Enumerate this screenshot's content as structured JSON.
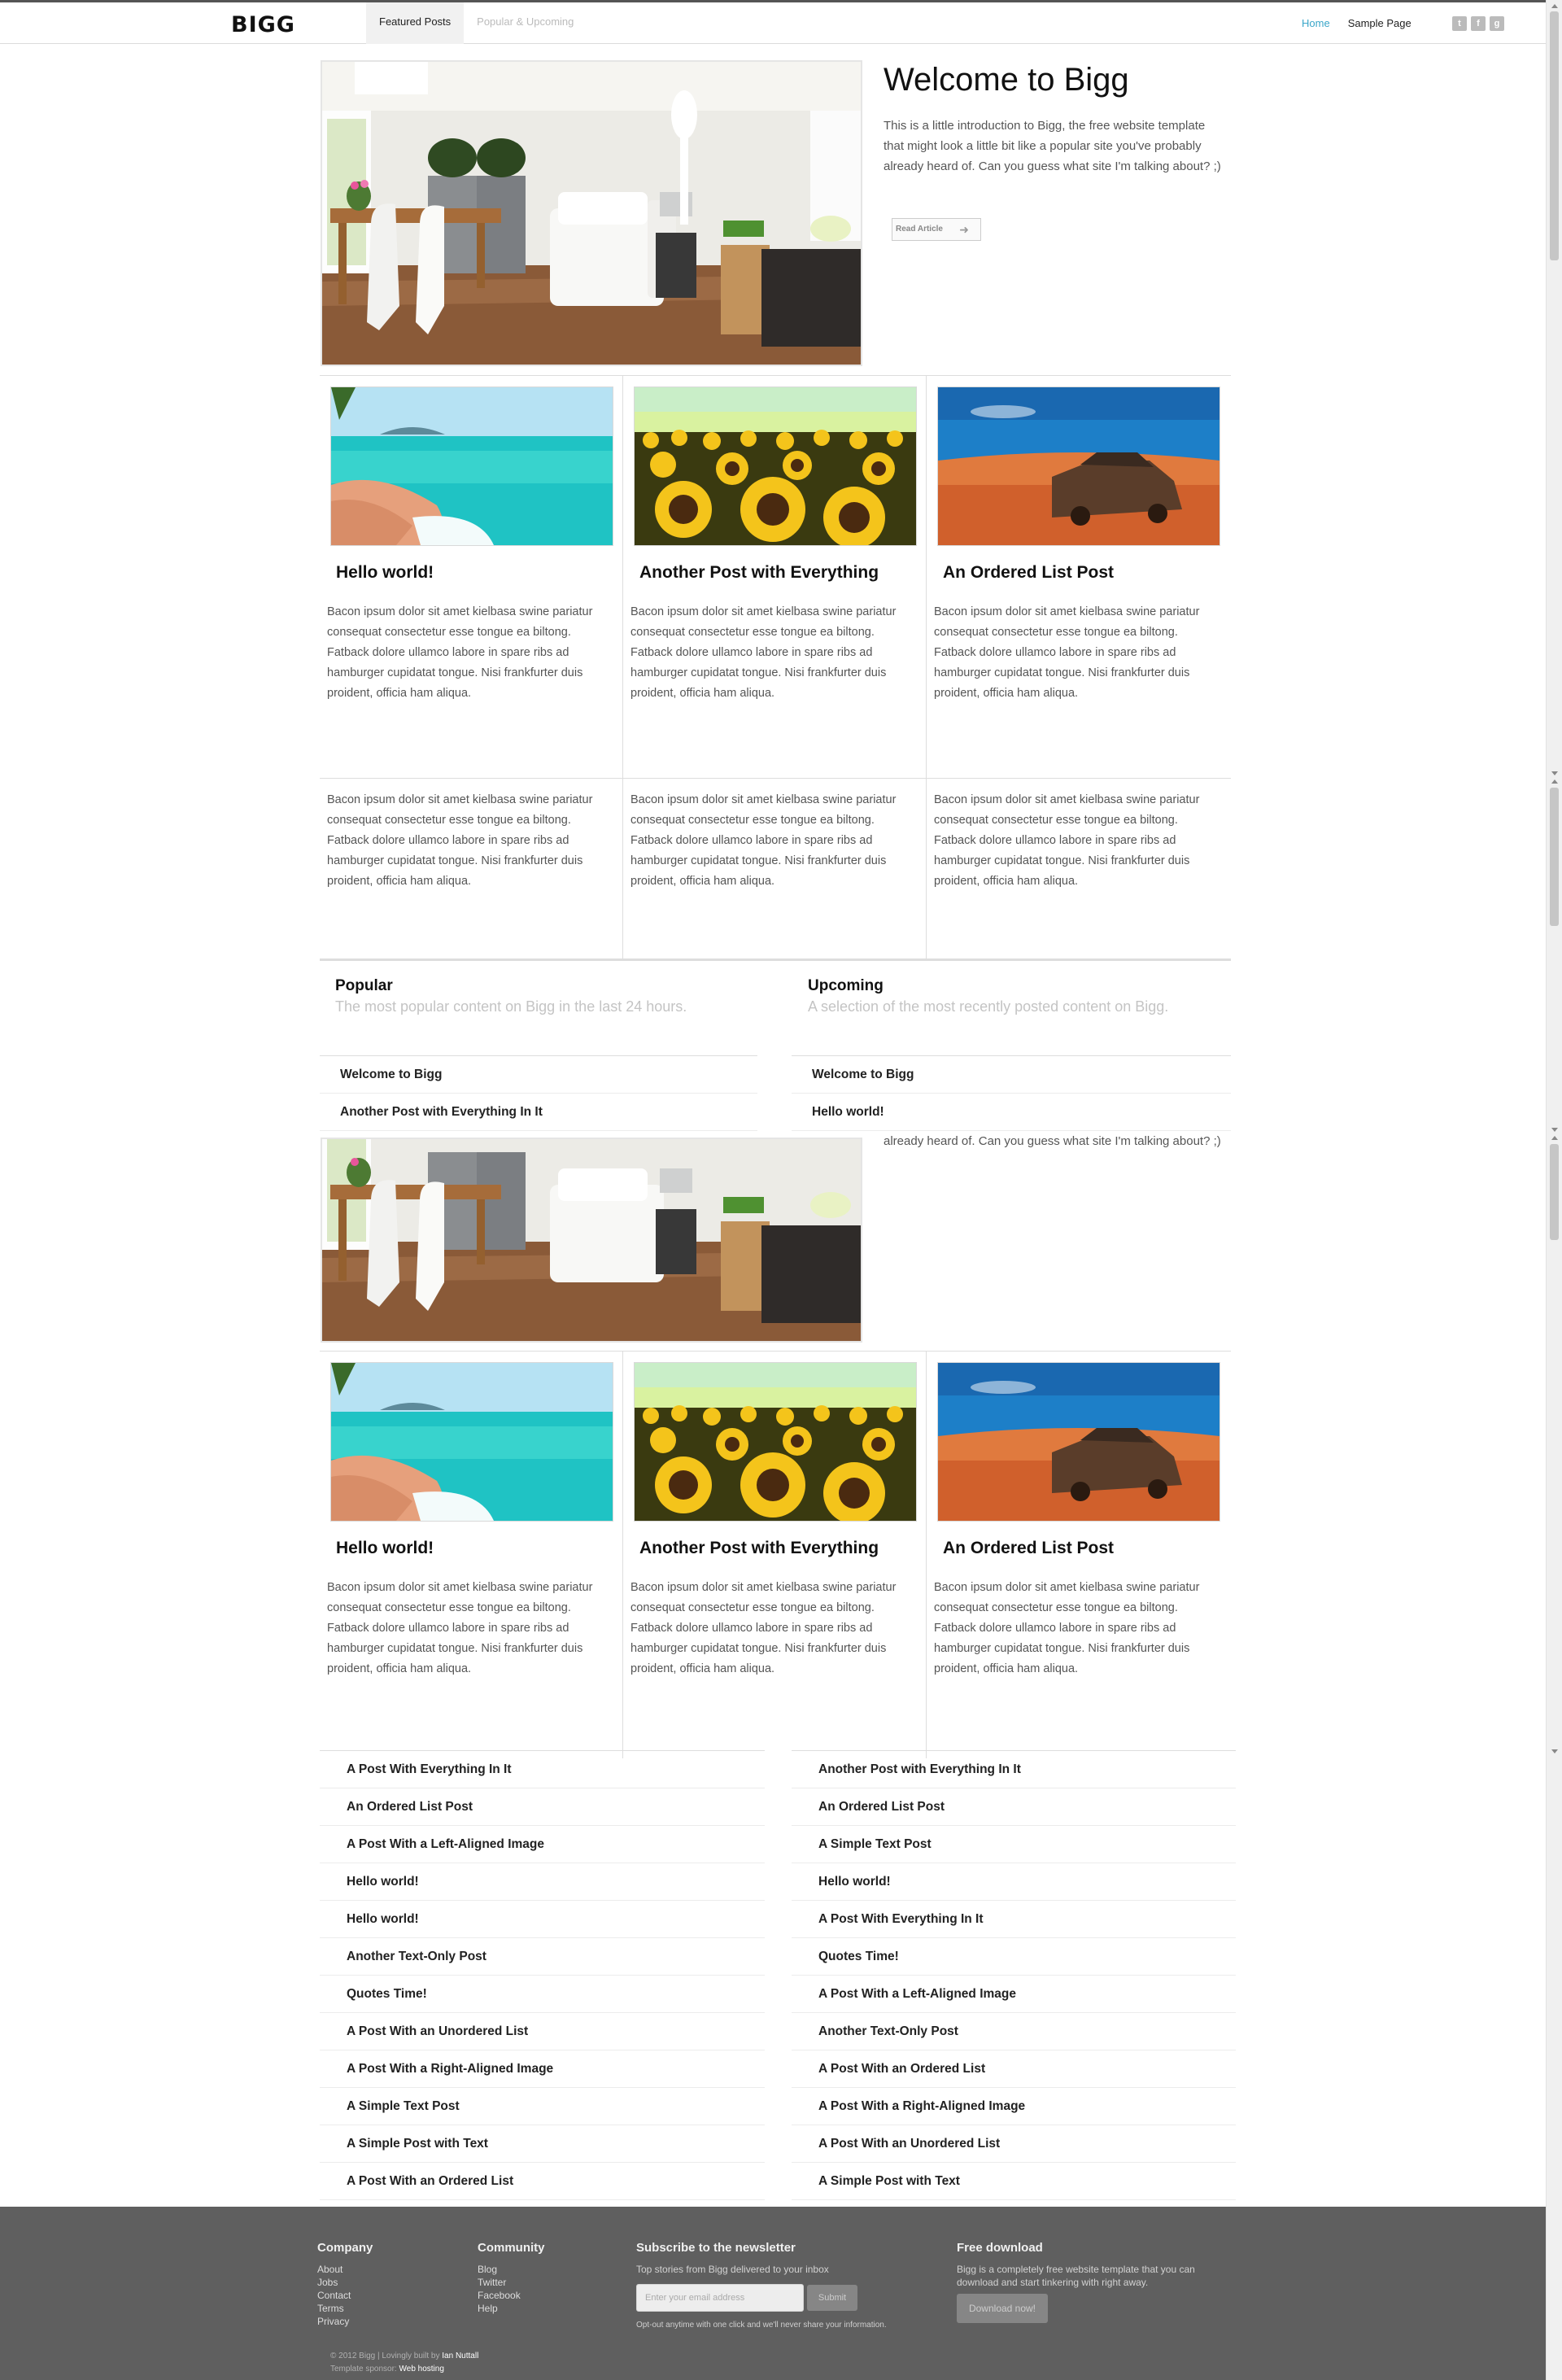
{
  "header": {
    "logo": "BIGG",
    "tabs": [
      {
        "label": "Featured Posts"
      },
      {
        "label": "Popular & Upcoming"
      }
    ],
    "nav_links": [
      {
        "label": "Home"
      },
      {
        "label": "Sample Page"
      }
    ],
    "social_icons": [
      "twitter-icon",
      "facebook-icon",
      "rss-icon"
    ],
    "accent_color": "#3aa6c9"
  },
  "hero": {
    "title": "Welcome to Bigg",
    "text": "This is a little introduction to Bigg, the free website template that might look a little bit like a popular site you've probably already heard of. Can you guess what site I'm talking about? ;)",
    "button_label": "Read Article",
    "text_repeat": "already heard of. Can you guess what site I'm talking about? ;)"
  },
  "posts": [
    {
      "title": "Hello world!",
      "excerpt": "Bacon ipsum dolor sit amet kielbasa swine pariatur consequat consectetur esse tongue ea biltong. Fatback dolore ullamco labore in spare ribs ad hamburger cupidatat tongue. Nisi frankfurter duis proident, officia ham aliqua.",
      "image": "beach"
    },
    {
      "title": "Another Post with Everything",
      "excerpt": "Bacon ipsum dolor sit amet kielbasa swine pariatur consequat consectetur esse tongue ea biltong. Fatback dolore ullamco labore in spare ribs ad hamburger cupidatat tongue. Nisi frankfurter duis proident, officia ham aliqua.",
      "image": "sunflowers"
    },
    {
      "title": "An Ordered List Post",
      "excerpt": "Bacon ipsum dolor sit amet kielbasa swine pariatur consequat consectetur esse tongue ea biltong. Fatback dolore ullamco labore in spare ribs ad hamburger cupidatat tongue. Nisi frankfurter duis proident, officia ham aliqua.",
      "image": "desert-car"
    }
  ],
  "row2_text": [
    "Bacon ipsum dolor sit amet kielbasa swine pariatur consequat consectetur esse tongue ea biltong. Fatback dolore ullamco labore in spare ribs ad hamburger cupidatat tongue. Nisi frankfurter duis proident, officia ham aliqua.",
    "Bacon ipsum dolor sit amet kielbasa swine pariatur consequat consectetur esse tongue ea biltong. Fatback dolore ullamco labore in spare ribs ad hamburger cupidatat tongue. Nisi frankfurter duis proident, officia ham aliqua.",
    "Bacon ipsum dolor sit amet kielbasa swine pariatur consequat consectetur esse tongue ea biltong. Fatback dolore ullamco labore in spare ribs ad hamburger cupidatat tongue. Nisi frankfurter duis proident, officia ham aliqua."
  ],
  "popular": {
    "heading": "Popular",
    "subheading": "The most popular content on Bigg in the last 24 hours.",
    "items": [
      "Welcome to Bigg",
      "Another Post with Everything In It"
    ]
  },
  "upcoming": {
    "heading": "Upcoming",
    "subheading": "A selection of the most recently posted content on Bigg.",
    "items": [
      "Welcome to Bigg",
      "Hello world!"
    ]
  },
  "popular_list": [
    "A Post With Everything In It",
    "An Ordered List Post",
    "A Post With a Left-Aligned Image",
    "Hello world!",
    "Hello world!",
    "Another Text-Only Post",
    "Quotes Time!",
    "A Post With an Unordered List",
    "A Post With a Right-Aligned Image",
    "A Simple Text Post",
    "A Simple Post with Text",
    "A Post With an Ordered List"
  ],
  "upcoming_list": [
    "Another Post with Everything In It",
    "An Ordered List Post",
    "A Simple Text Post",
    "Hello world!",
    "A Post With Everything In It",
    "Quotes Time!",
    "A Post With a Left-Aligned Image",
    "Another Text-Only Post",
    "A Post With an Ordered List",
    "A Post With a Right-Aligned Image",
    "A Post With an Unordered List",
    "A Simple Post with Text"
  ],
  "footer": {
    "company": {
      "heading": "Company",
      "links": [
        "About",
        "Jobs",
        "Contact",
        "Terms",
        "Privacy"
      ]
    },
    "community": {
      "heading": "Community",
      "links": [
        "Blog",
        "Twitter",
        "Facebook",
        "Help"
      ]
    },
    "newsletter": {
      "heading": "Subscribe to the newsletter",
      "description": "Top stories from Bigg delivered to your inbox",
      "placeholder": "Enter your email address",
      "submit_label": "Submit",
      "optout": "Opt-out anytime with one click and we'll never share your information."
    },
    "download": {
      "heading": "Free download",
      "description": "Bigg is a completely free website template that you can download and start tinkering with right away.",
      "button_label": "Download now!"
    },
    "copyright_prefix": "© 2012 Bigg | Lovingly built by",
    "copyright_author": "Ian Nuttall",
    "sponsor_prefix": "Template sponsor:",
    "sponsor_link": "Web hosting",
    "bg_color": "#5f5f5f"
  }
}
